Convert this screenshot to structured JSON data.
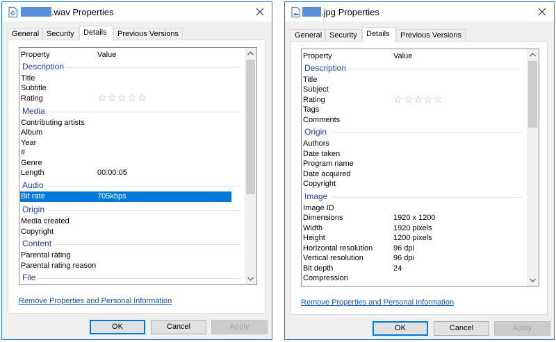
{
  "left_dialog": {
    "title": ".wav Properties",
    "tabs": [
      "General",
      "Security",
      "Details",
      "Previous Versions"
    ],
    "active_tab": "Details",
    "columns": {
      "property": "Property",
      "value": "Value"
    },
    "groups": {
      "description": "Description",
      "media": "Media",
      "audio": "Audio",
      "origin": "Origin",
      "content": "Content",
      "file": "File"
    },
    "rows": {
      "title": "Title",
      "subtitle": "Subtitle",
      "rating": "Rating",
      "contributing_artists": "Contributing artists",
      "album": "Album",
      "year": "Year",
      "number": "#",
      "genre": "Genre",
      "length": "Length",
      "length_value": "00:00:05",
      "bit_rate": "Bit rate",
      "bit_rate_value": "705kbps",
      "media_created": "Media created",
      "copyright": "Copyright",
      "parental_rating": "Parental rating",
      "parental_rating_reason": "Parental rating reason"
    },
    "rating_stars": "☆☆☆☆☆",
    "remove_link": "Remove Properties and Personal Information",
    "buttons": {
      "ok": "OK",
      "cancel": "Cancel",
      "apply": "Apply"
    }
  },
  "right_dialog": {
    "title": ".jpg Properties",
    "tabs": [
      "General",
      "Security",
      "Details",
      "Previous Versions"
    ],
    "active_tab": "Details",
    "columns": {
      "property": "Property",
      "value": "Value"
    },
    "groups": {
      "description": "Description",
      "origin": "Origin",
      "image": "Image"
    },
    "rows": {
      "title": "Title",
      "subject": "Subject",
      "rating": "Rating",
      "tags": "Tags",
      "comments": "Comments",
      "authors": "Authors",
      "date_taken": "Date taken",
      "program_name": "Program name",
      "date_acquired": "Date acquired",
      "copyright": "Copyright",
      "image_id": "Image ID",
      "dimensions": "Dimensions",
      "dimensions_value": "1920 x 1200",
      "width": "Width",
      "width_value": "1920 pixels",
      "height": "Height",
      "height_value": "1200 pixels",
      "h_res": "Horizontal resolution",
      "h_res_value": "96 dpi",
      "v_res": "Vertical resolution",
      "v_res_value": "96 dpi",
      "bit_depth": "Bit depth",
      "bit_depth_value": "24",
      "compression": "Compression"
    },
    "rating_stars": "☆☆☆☆☆",
    "remove_link": "Remove Properties and Personal Information",
    "buttons": {
      "ok": "OK",
      "cancel": "Cancel",
      "apply": "Apply"
    }
  },
  "colors": {
    "accent": "#0078d7",
    "link": "#0a54c5",
    "group_header": "#1f3f9f"
  },
  "icons": {
    "close": "close-icon",
    "wav_file": "audio-file-icon",
    "jpg_file": "image-file-icon",
    "scroll_up": "chevron-up-icon",
    "scroll_down": "chevron-down-icon"
  }
}
